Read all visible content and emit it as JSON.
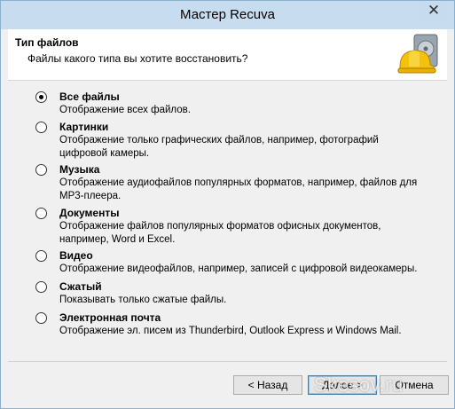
{
  "window": {
    "title": "Мастер Recuva",
    "close_glyph": "✕"
  },
  "header": {
    "title": "Тип файлов",
    "subtitle": "Файлы какого типа вы хотите восстановить?",
    "logo_icon": "recuva-hardhat-drive-icon"
  },
  "options": [
    {
      "label": "Все файлы",
      "desc": "Отображение всех файлов.",
      "checked": true
    },
    {
      "label": "Картинки",
      "desc": "Отображение только графических файлов, например, фотографий цифровой камеры.",
      "checked": false
    },
    {
      "label": "Музыка",
      "desc": "Отображение аудиофайлов популярных форматов, например, файлов для MP3-плеера.",
      "checked": false
    },
    {
      "label": "Документы",
      "desc": "Отображение файлов популярных форматов офисных документов, например, Word и Excel.",
      "checked": false
    },
    {
      "label": "Видео",
      "desc": "Отображение видеофайлов, например, записей с цифровой видеокамеры.",
      "checked": false
    },
    {
      "label": "Сжатый",
      "desc": "Показывать только сжатые файлы.",
      "checked": false
    },
    {
      "label": "Электронная почта",
      "desc": "Отображение эл. писем из Thunderbird, Outlook Express и Windows Mail.",
      "checked": false
    }
  ],
  "buttons": {
    "back": "< Назад",
    "next": "Далее >",
    "cancel": "Отмена"
  },
  "watermark": "Skesov.ru",
  "colors": {
    "titlebar": "#c8dcef",
    "dialog_bg": "#f0f0f0",
    "accent_border": "#3c7fb1"
  }
}
